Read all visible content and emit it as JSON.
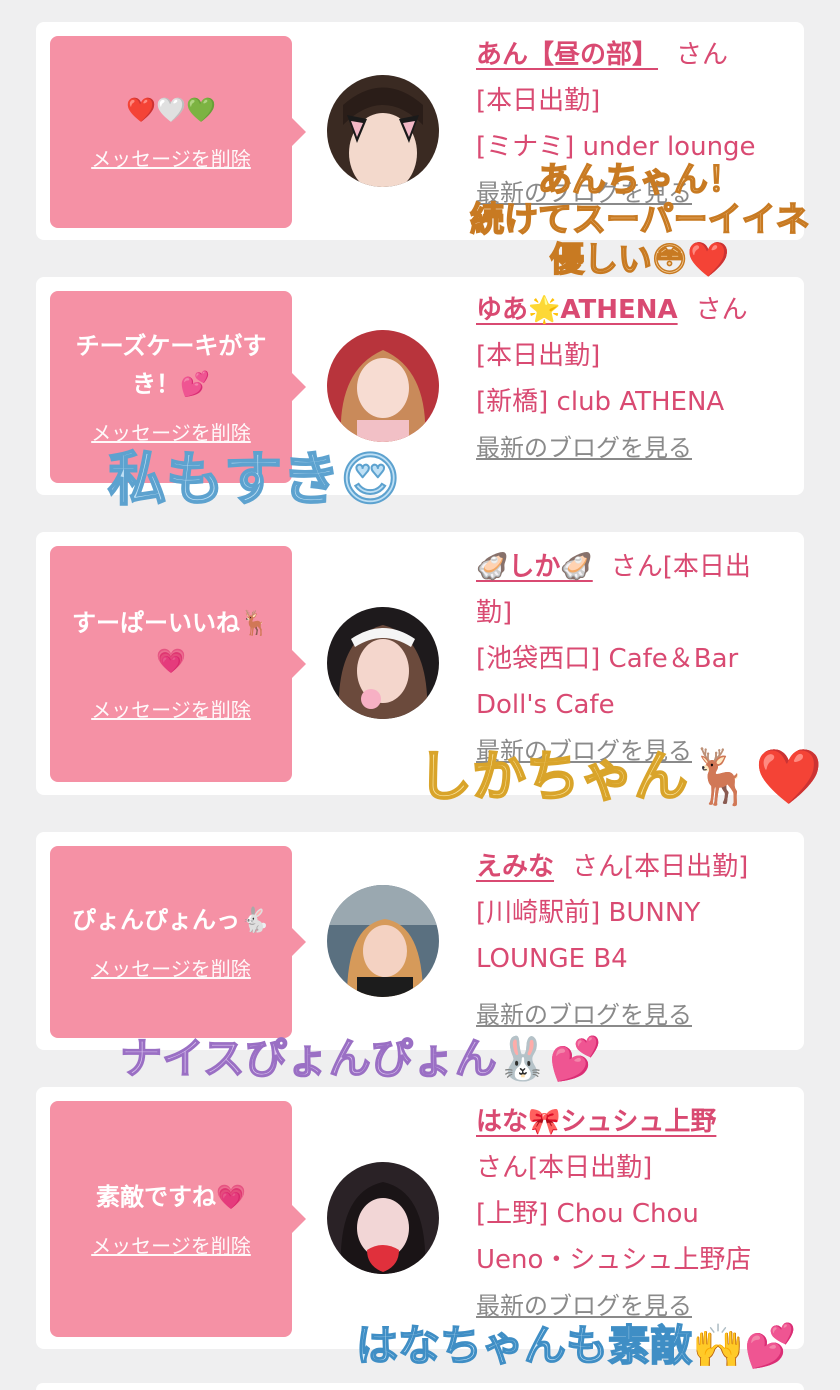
{
  "cards": [
    {
      "message": "❤️🤍💚",
      "delete_label": "メッセージを削除",
      "name": "あん【昼の部】",
      "honorific": "さん",
      "status": "[本日出勤]",
      "shop": "[ミナミ] under lounge",
      "blog_label": "最新のブログを見る"
    },
    {
      "message": "チーズケーキがすき！💕",
      "delete_label": "メッセージを削除",
      "name": "ゆあ🌟ATHENA",
      "honorific": "さん",
      "status": "[本日出勤]",
      "shop": "[新橋] club ATHENA",
      "blog_label": "最新のブログを見る"
    },
    {
      "message": "すーぱーいいね🦌💗",
      "delete_label": "メッセージを削除",
      "name": "🦪しか🦪",
      "honorific": "さん[本日出",
      "status": "勤]",
      "shop": "[池袋西口] Cafe＆Bar",
      "shop2": "Doll's Cafe",
      "blog_label": "最新のブログを見る"
    },
    {
      "message": "ぴょんぴょんっ🐇",
      "delete_label": "メッセージを削除",
      "name": "えみな",
      "honorific": "さん[本日出勤]",
      "status": "[川崎駅前] BUNNY",
      "shop": "LOUNGE B4",
      "blog_label": "最新のブログを見る"
    },
    {
      "message": "素敵ですね💗",
      "delete_label": "メッセージを削除",
      "name": "はな🎀シュシュ上野",
      "honorific": "さん[本日出勤]",
      "status": "[上野] Chou Chou",
      "shop": "Ueno・シュシュ上野店",
      "blog_label": "最新のブログを見る"
    }
  ],
  "overlays": {
    "ov1_line1": "あんちゃん！",
    "ov1_line2": "続けてスーパーイイネ",
    "ov1_line3": "優しい😳❤️",
    "ov2": "私もすき😍",
    "ov3": "しかちゃん🦌❤️",
    "ov4": "ナイスぴょんぴょん🐰💕",
    "ov5": "はなちゃんも素敵🙌💕"
  }
}
